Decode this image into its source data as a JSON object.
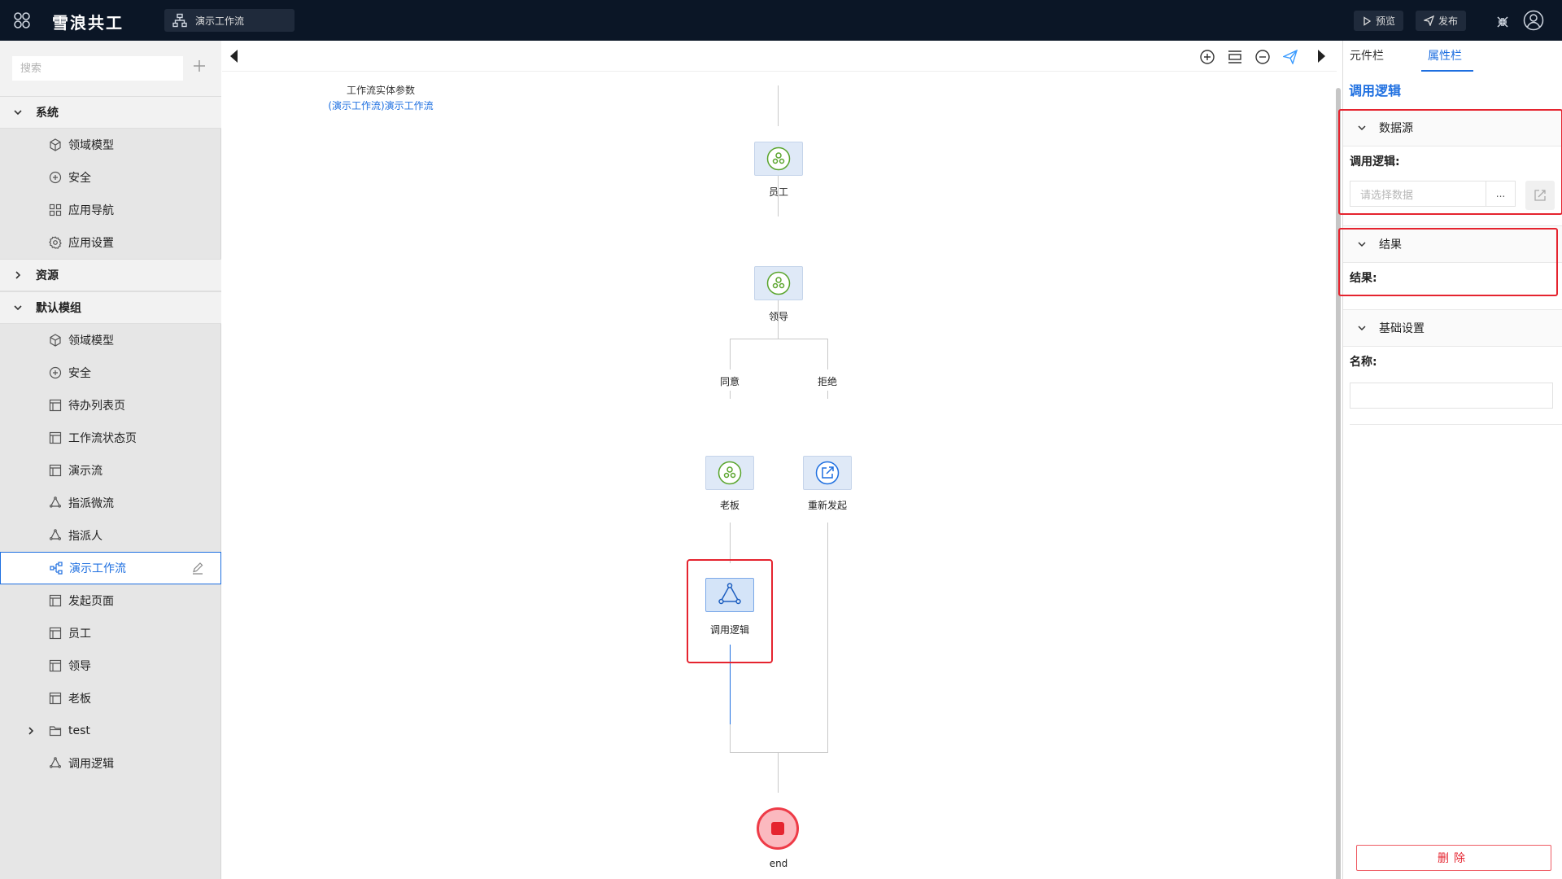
{
  "app": {
    "brand": "雪浪共工",
    "current_tab": "演示工作流",
    "preview_label": "预览",
    "publish_label": "发布"
  },
  "sidebar": {
    "search_placeholder": "搜索",
    "groups": [
      {
        "label": "系统",
        "expanded": true,
        "items": [
          "领域模型",
          "安全",
          "应用导航",
          "应用设置"
        ]
      },
      {
        "label": "资源",
        "expanded": false,
        "items": []
      },
      {
        "label": "默认模组",
        "expanded": true,
        "items": [
          "领域模型",
          "安全",
          "待办列表页",
          "工作流状态页",
          "演示流",
          "指派微流",
          "指派人",
          "演示工作流",
          "发起页面",
          "员工",
          "领导",
          "老板",
          "test",
          "调用逻辑"
        ]
      }
    ],
    "active_item": "演示工作流"
  },
  "canvas": {
    "entity_param_title": "工作流实体参数",
    "entity_param_value": "(演示工作流)演示工作流",
    "nodes": {
      "employee": "员工",
      "leader": "领导",
      "boss": "老板",
      "restart": "重新发起",
      "call_logic": "调用逻辑",
      "end": "end"
    },
    "branches": {
      "agree": "同意",
      "reject": "拒绝"
    }
  },
  "right_panel": {
    "tabs": [
      "元件栏",
      "属性栏"
    ],
    "active_tab": "属性栏",
    "title": "调用逻辑",
    "sections": {
      "datasource": "数据源",
      "result": "结果",
      "basic": "基础设置"
    },
    "fields": {
      "call_logic_label": "调用逻辑:",
      "call_logic_placeholder": "请选择数据",
      "dots": "...",
      "result_label": "结果:",
      "name_label": "名称:"
    },
    "delete_label": "删除"
  },
  "colors": {
    "accent": "#1e6fe0",
    "highlight": "#e5242f",
    "topbar": "#0b1626"
  }
}
